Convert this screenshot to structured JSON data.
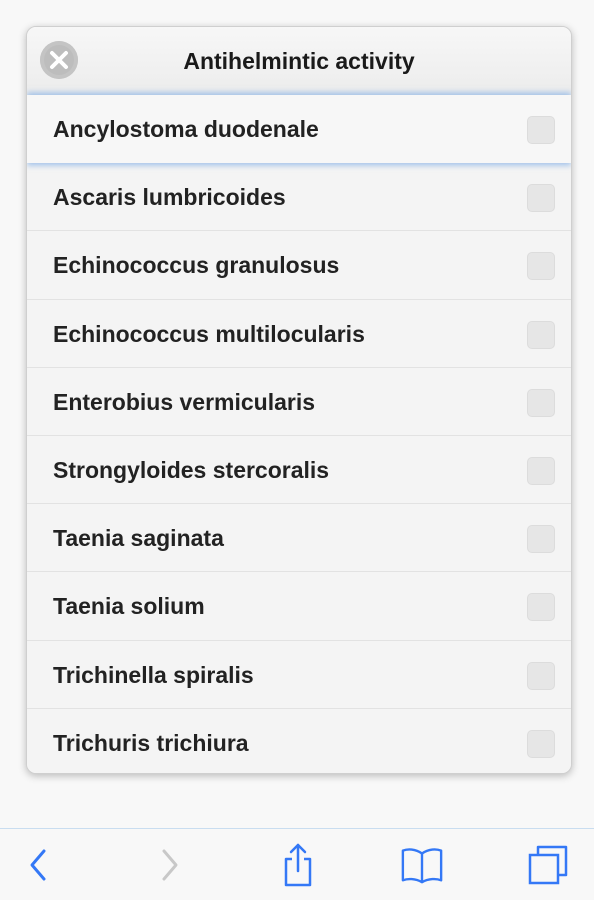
{
  "dialog": {
    "title": "Antihelmintic activity",
    "close_icon": "close-circle-icon"
  },
  "items": [
    {
      "label": "Ancylostoma duodenale",
      "selected": true,
      "checked": false
    },
    {
      "label": "Ascaris lumbricoides",
      "selected": false,
      "checked": false
    },
    {
      "label": "Echinococcus granulosus",
      "selected": false,
      "checked": false
    },
    {
      "label": "Echinococcus multilocularis",
      "selected": false,
      "checked": false
    },
    {
      "label": "Enterobius vermicularis",
      "selected": false,
      "checked": false
    },
    {
      "label": "Strongyloides stercoralis",
      "selected": false,
      "checked": false
    },
    {
      "label": "Taenia saginata",
      "selected": false,
      "checked": false
    },
    {
      "label": "Taenia solium",
      "selected": false,
      "checked": false
    },
    {
      "label": "Trichinella spiralis",
      "selected": false,
      "checked": false
    },
    {
      "label": "Trichuris trichiura",
      "selected": false,
      "checked": false
    }
  ],
  "toolbar": {
    "accent": "#3478f6",
    "disabled": "#c8c8c8",
    "buttons": [
      "back-icon",
      "forward-icon",
      "share-icon",
      "bookmarks-icon",
      "tabs-icon"
    ]
  }
}
